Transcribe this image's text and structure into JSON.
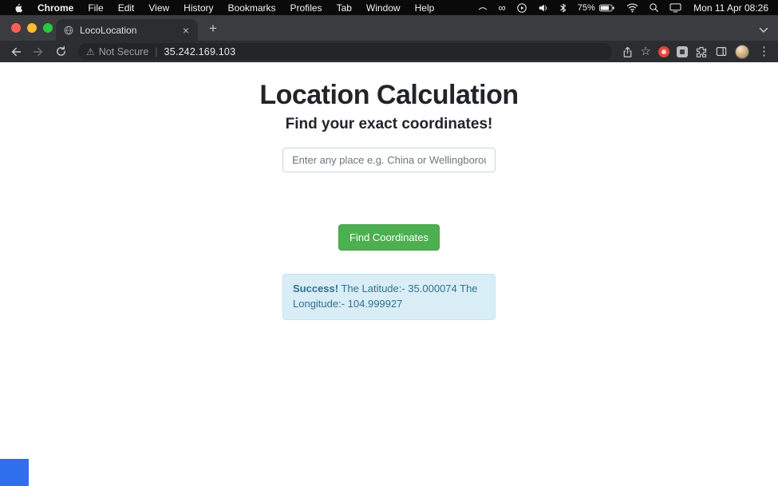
{
  "menubar": {
    "items": [
      "Chrome",
      "File",
      "Edit",
      "View",
      "History",
      "Bookmarks",
      "Profiles",
      "Tab",
      "Window",
      "Help"
    ],
    "battery_percent": "75%",
    "clock": "Mon 11 Apr 08:26"
  },
  "browser": {
    "tab_title": "LocoLocation",
    "security_label": "Not Secure",
    "url": "35.242.169.103"
  },
  "page": {
    "title": "Location Calculation",
    "subtitle": "Find your exact coordinates!",
    "search_placeholder": "Enter any place e.g. China or Wellingborough",
    "find_button": "Find Coordinates",
    "alert_bold": "Success!",
    "alert_text": "The Latitude:- 35.000074 The Longitude:- 104.999927"
  },
  "icons": {
    "close": "×",
    "plus": "+",
    "warning": "⚠",
    "separator": "|",
    "star": "☆",
    "kebab": "⋮",
    "glasses": "∞"
  },
  "colors": {
    "button_green": "#4caf50",
    "alert_bg": "#d9edf7",
    "alert_border": "#bce8f1",
    "alert_text": "#31708f",
    "menubar_bg": "#0a0a0b",
    "toolbar_bg": "#2c2d30"
  }
}
